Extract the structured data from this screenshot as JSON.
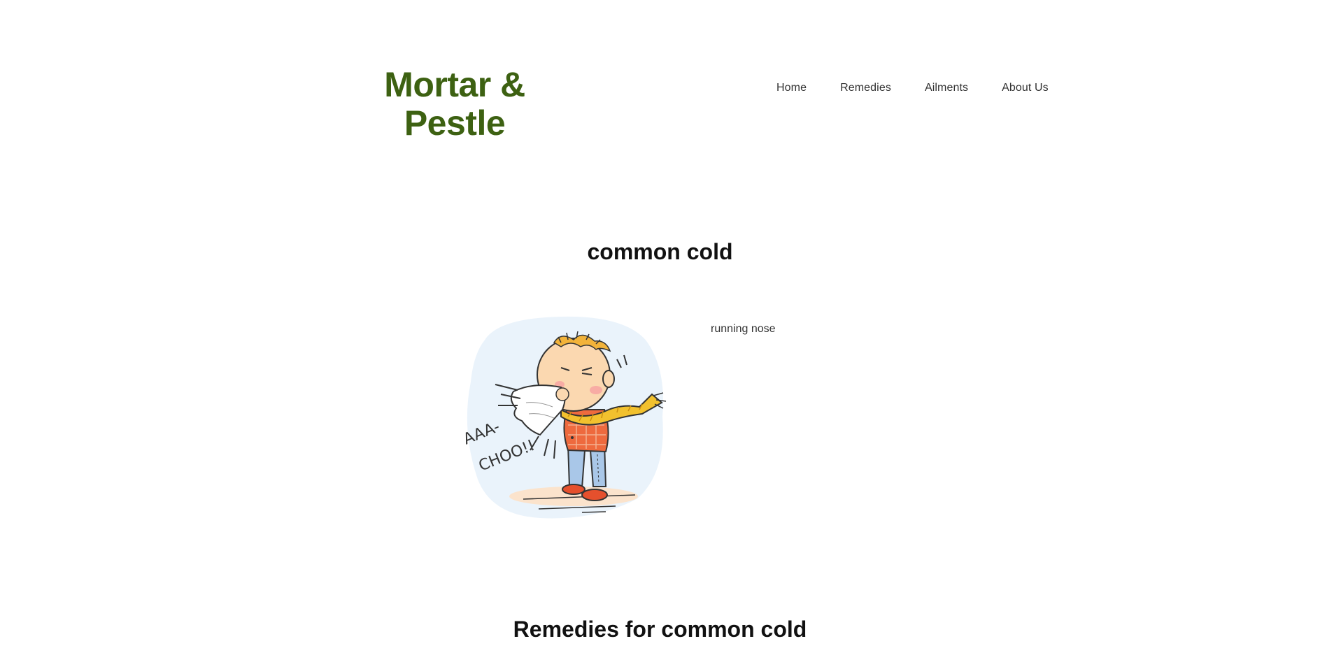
{
  "header": {
    "logo": "Mortar &\nPestle",
    "logo_color": "#3d6112",
    "nav": [
      {
        "label": "Home"
      },
      {
        "label": "Remedies"
      },
      {
        "label": "Ailments"
      },
      {
        "label": "About Us"
      }
    ]
  },
  "ailment": {
    "title": "common cold",
    "image_icon": "sneezing-child-illustration",
    "illustration_text": "AAA-\nCHOO!!",
    "symptoms": [
      "running nose"
    ]
  },
  "remedies": {
    "title": "Remedies for common cold"
  }
}
